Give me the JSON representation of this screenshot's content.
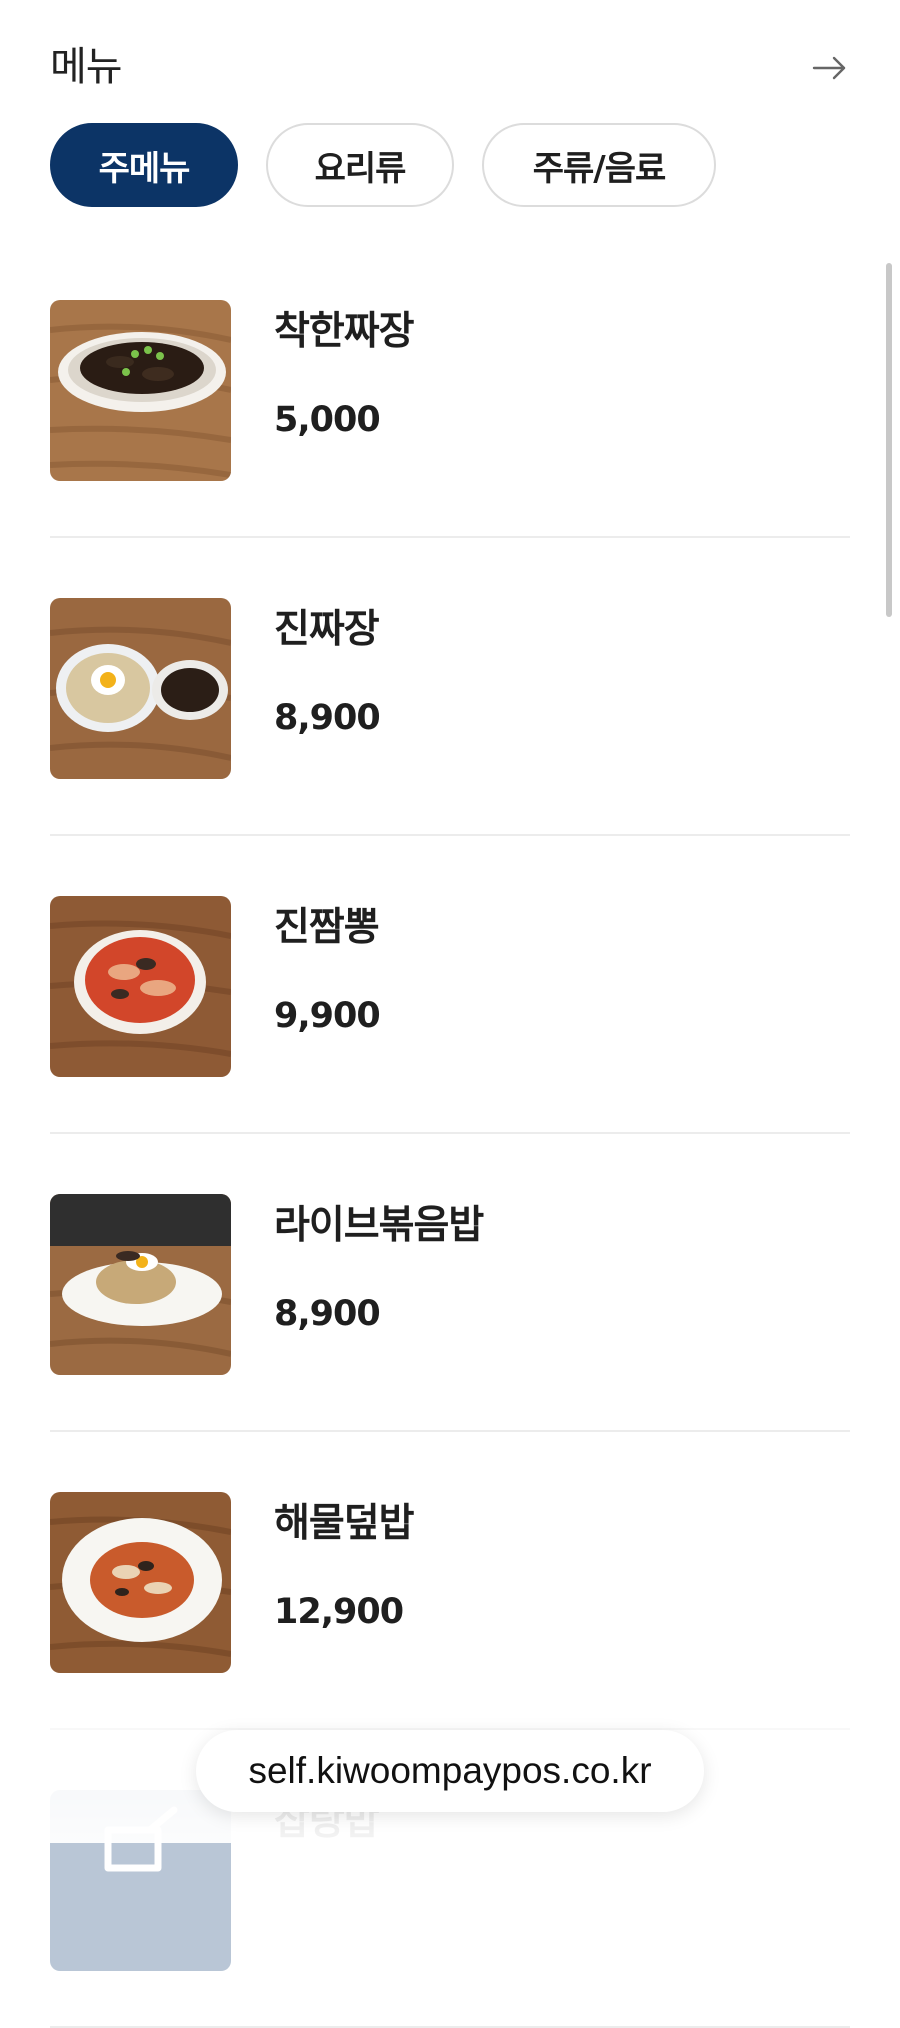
{
  "header": {
    "title": "메뉴",
    "arrow_icon": "arrow-right-icon"
  },
  "tabs": [
    {
      "label": "주메뉴",
      "active": true
    },
    {
      "label": "요리류",
      "active": false
    },
    {
      "label": "주류/음료",
      "active": false
    }
  ],
  "menu_items": [
    {
      "name": "착한짜장",
      "price": "5,000",
      "image": "jjajang-bowl"
    },
    {
      "name": "진짜장",
      "price": "8,900",
      "image": "jjajang-set"
    },
    {
      "name": "진짬뽕",
      "price": "9,900",
      "image": "jjamppong-bowl"
    },
    {
      "name": "라이브볶음밥",
      "price": "8,900",
      "image": "fried-rice-plate"
    },
    {
      "name": "해물덮밥",
      "price": "12,900",
      "image": "seafood-rice-plate"
    },
    {
      "name": "잡탕밥",
      "price": "",
      "image": "placeholder"
    }
  ],
  "url_bar": {
    "text": "self.kiwoompaypos.co.kr"
  },
  "colors": {
    "accent": "#0c3466",
    "divider": "#ececec",
    "tab_border": "#dcdcdc"
  }
}
